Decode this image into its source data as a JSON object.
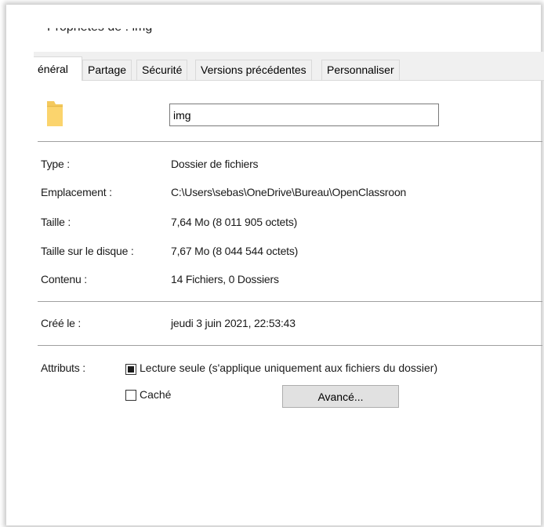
{
  "window": {
    "title": "Propriétés de : img"
  },
  "tabs": [
    {
      "label": "énéral",
      "active": true
    },
    {
      "label": "Partage",
      "active": false
    },
    {
      "label": "Sécurité",
      "active": false
    },
    {
      "label": "Versions précédentes",
      "active": false
    },
    {
      "label": "Personnaliser",
      "active": false
    }
  ],
  "general": {
    "folder_icon": "folder-icon",
    "name_value": "img",
    "type_label": "Type :",
    "type_value": "Dossier de fichiers",
    "location_label": "Emplacement :",
    "location_value": "C:\\Users\\sebas\\OneDrive\\Bureau\\OpenClassroon",
    "size_label": "Taille :",
    "size_value": "7,64 Mo (8 011 905 octets)",
    "disk_size_label": "Taille sur le disque :",
    "disk_size_value": "7,67 Mo (8 044 544 octets)",
    "contents_label": "Contenu :",
    "contents_value": "14 Fichiers, 0 Dossiers",
    "created_label": "Créé le :",
    "created_value": "jeudi 3 juin 2021, 22:53:43",
    "attributes_label": "Attributs :",
    "readonly_label": "Lecture seule (s'applique uniquement aux fichiers du dossier)",
    "readonly_state": "indeterminate",
    "hidden_label": "Caché",
    "hidden_checked": false,
    "advanced_button": "Avancé..."
  },
  "colors": {
    "folder": "#f4c95d",
    "tabbar_bg": "#f0f0f0",
    "separator": "#a0a0a0",
    "button_bg": "#e1e1e1"
  }
}
